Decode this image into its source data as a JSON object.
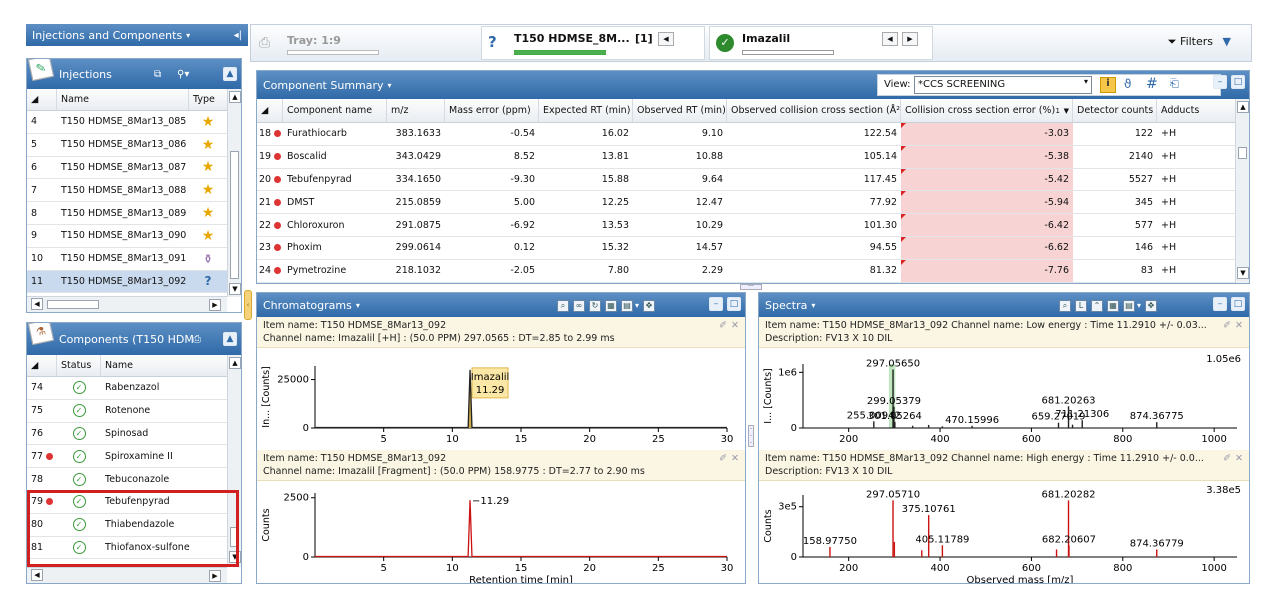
{
  "left_header": {
    "title": "Injections and Components"
  },
  "injections": {
    "title": "Injections",
    "columns": [
      "Name",
      "Type"
    ],
    "rows": [
      {
        "idx": "4",
        "name": "T150 HDMSE_8Mar13_085"
      },
      {
        "idx": "5",
        "name": "T150 HDMSE_8Mar13_086"
      },
      {
        "idx": "6",
        "name": "T150 HDMSE_8Mar13_087"
      },
      {
        "idx": "7",
        "name": "T150 HDMSE_8Mar13_088"
      },
      {
        "idx": "8",
        "name": "T150 HDMSE_8Mar13_089"
      },
      {
        "idx": "9",
        "name": "T150 HDMSE_8Mar13_090"
      },
      {
        "idx": "10",
        "name": "T150 HDMSE_8Mar13_091"
      },
      {
        "idx": "11",
        "name": "T150 HDMSE_8Mar13_092"
      }
    ]
  },
  "components": {
    "title": "Components (T150 HDM",
    "columns": [
      "Status",
      "Name"
    ],
    "rows": [
      {
        "idx": "74",
        "name": "Rabenzazol"
      },
      {
        "idx": "75",
        "name": "Rotenone"
      },
      {
        "idx": "76",
        "name": "Spinosad"
      },
      {
        "idx": "77",
        "name": "Spiroxamine II"
      },
      {
        "idx": "78",
        "name": "Tebuconazole"
      },
      {
        "idx": "79",
        "name": "Tebufenpyrad"
      },
      {
        "idx": "80",
        "name": "Thiabendazole"
      },
      {
        "idx": "81",
        "name": "Thiofanox-sulfone"
      }
    ]
  },
  "toolbar": {
    "tray_label": "Tray: 1:9",
    "injection_label": "T150 HDMSE_8M...",
    "injection_count": "[1]",
    "component_label": "Imazalil",
    "filters_label": "Filters"
  },
  "summary": {
    "title": "Component Summary",
    "view_label": "View:",
    "view_value": "*CCS SCREENING",
    "columns": [
      "Component name",
      "m/z",
      "Mass error (ppm)",
      "Expected RT (min)",
      "Observed RT (min)",
      "Observed collision cross section (Å²)",
      "Collision cross section error (%)",
      "Detector counts",
      "Adducts"
    ],
    "sort_marker": "1",
    "rows": [
      {
        "idx": "18",
        "name": "Furathiocarb",
        "mz": "383.1633",
        "err": "-0.54",
        "exp": "16.02",
        "obs": "9.10",
        "ccs": "122.54",
        "ccserr": "-3.03",
        "counts": "122",
        "adduct": "+H"
      },
      {
        "idx": "19",
        "name": "Boscalid",
        "mz": "343.0429",
        "err": "8.52",
        "exp": "13.81",
        "obs": "10.88",
        "ccs": "105.14",
        "ccserr": "-5.38",
        "counts": "2140",
        "adduct": "+H"
      },
      {
        "idx": "20",
        "name": "Tebufenpyrad",
        "mz": "334.1650",
        "err": "-9.30",
        "exp": "15.88",
        "obs": "9.64",
        "ccs": "117.45",
        "ccserr": "-5.42",
        "counts": "5527",
        "adduct": "+H"
      },
      {
        "idx": "21",
        "name": "DMST",
        "mz": "215.0859",
        "err": "5.00",
        "exp": "12.25",
        "obs": "12.47",
        "ccs": "77.92",
        "ccserr": "-5.94",
        "counts": "345",
        "adduct": "+H"
      },
      {
        "idx": "22",
        "name": "Chloroxuron",
        "mz": "291.0875",
        "err": "-6.92",
        "exp": "13.53",
        "obs": "10.29",
        "ccs": "101.30",
        "ccserr": "-6.42",
        "counts": "577",
        "adduct": "+H"
      },
      {
        "idx": "23",
        "name": "Phoxim",
        "mz": "299.0614",
        "err": "0.12",
        "exp": "15.32",
        "obs": "14.57",
        "ccs": "94.55",
        "ccserr": "-6.62",
        "counts": "146",
        "adduct": "+H"
      },
      {
        "idx": "24",
        "name": "Pymetrozine",
        "mz": "218.1032",
        "err": "-2.05",
        "exp": "7.80",
        "obs": "2.29",
        "ccs": "81.32",
        "ccserr": "-7.76",
        "counts": "83",
        "adduct": "+H"
      }
    ]
  },
  "chromatograms": {
    "title": "Chromatograms",
    "panel1": {
      "item": "Item name: T150 HDMSE_8Mar13_092",
      "channel": "Channel name: Imazalil [+H] : (50.0 PPM) 297.0565 : DT=2.85 to 2.99 ms"
    },
    "panel2": {
      "item": "Item name: T150 HDMSE_8Mar13_092",
      "channel": "Channel name: Imazalil [Fragment] : (50.0 PPM) 158.9775 : DT=2.77 to 2.90 ms"
    }
  },
  "spectra": {
    "title": "Spectra",
    "panel1": {
      "item": "Item name: T150 HDMSE_8Mar13_092   Channel name: Low energy : Time 11.2910 +/- 0.03...",
      "desc": "Description: FV13 X 10 DIL"
    },
    "panel2": {
      "item": "Item name: T150 HDMSE_8Mar13_092   Channel name: High energy : Time 11.2910 +/- 0.0...",
      "desc": "Description: FV13 X 10 DIL"
    }
  },
  "chart_data": [
    {
      "type": "line",
      "panel": "chromatogram-1",
      "ylabel": "In... [Counts]",
      "xlim": [
        0,
        30
      ],
      "ylim": [
        0,
        32000
      ],
      "xticks": [
        5,
        10,
        15,
        20,
        25,
        30
      ],
      "yticks": [
        {
          "v": 0,
          "label": "0"
        },
        {
          "v": 25000,
          "label": "25000"
        }
      ],
      "peaks": [
        {
          "x": 11.29,
          "y": 30000,
          "width": 0.14
        }
      ],
      "peak_label": {
        "text": "Imazalil",
        "value": "11.29"
      },
      "color": "#222222",
      "fill": "#c8a84a"
    },
    {
      "type": "line",
      "panel": "chromatogram-2",
      "ylabel": "Counts",
      "xlabel": "Retention time [min]",
      "xlim": [
        0,
        30
      ],
      "ylim": [
        0,
        2700
      ],
      "xticks": [
        5,
        10,
        15,
        20,
        25,
        30
      ],
      "yticks": [
        {
          "v": 0,
          "label": "0"
        },
        {
          "v": 2500,
          "label": "2500"
        }
      ],
      "peaks": [
        {
          "x": 11.29,
          "y": 2400,
          "width": 0.14
        }
      ],
      "annotations": [
        {
          "x": 11.29,
          "y": 2400,
          "text": "11.29"
        }
      ],
      "color": "#cc1111"
    },
    {
      "type": "bar",
      "panel": "spectrum-1",
      "ylabel": "I... [Counts]",
      "xlim": [
        100,
        1050
      ],
      "ylim": [
        0,
        1150000
      ],
      "xticks": [
        200,
        400,
        600,
        800,
        1000
      ],
      "yticks": [
        {
          "v": 0,
          "label": "0"
        },
        {
          "v": 1000000,
          "label": "1e6"
        }
      ],
      "max_label": "1.05e6",
      "highlight": [
        288,
        302
      ],
      "peaks": [
        {
          "x": 297.0565,
          "y": 1050000
        },
        {
          "x": 299.05379,
          "y": 380000
        },
        {
          "x": 255.00942,
          "y": 120000
        },
        {
          "x": 301.05264,
          "y": 110000
        },
        {
          "x": 470.15996,
          "y": 40000
        },
        {
          "x": 659.27019,
          "y": 95000
        },
        {
          "x": 681.20263,
          "y": 390000
        },
        {
          "x": 711.21306,
          "y": 140000
        },
        {
          "x": 874.36775,
          "y": 105000
        },
        {
          "x": 340,
          "y": 40000
        },
        {
          "x": 375,
          "y": 55000
        },
        {
          "x": 405,
          "y": 30000
        },
        {
          "x": 690,
          "y": 60000
        }
      ],
      "labels": [
        {
          "x": 297.0565,
          "y": 1050000,
          "text": "297.05650"
        },
        {
          "x": 299.05379,
          "y": 380000,
          "text": "299.05379"
        },
        {
          "x": 255.00942,
          "y": 120000,
          "text": "255.00942"
        },
        {
          "x": 301.05264,
          "y": 110000,
          "text": "301.05264"
        },
        {
          "x": 470.15996,
          "y": 40000,
          "text": "470.15996"
        },
        {
          "x": 659.27019,
          "y": 95000,
          "text": "659.27019"
        },
        {
          "x": 681.20263,
          "y": 390000,
          "text": "681.20263"
        },
        {
          "x": 711.21306,
          "y": 140000,
          "text": "711.21306"
        },
        {
          "x": 874.36775,
          "y": 105000,
          "text": "874.36775"
        }
      ],
      "color": "#222222"
    },
    {
      "type": "bar",
      "panel": "spectrum-2",
      "ylabel": "Counts",
      "xlabel": "Observed mass [m/z]",
      "xlim": [
        100,
        1050
      ],
      "ylim": [
        0,
        3700000
      ],
      "xticks": [
        200,
        400,
        600,
        800,
        1000
      ],
      "yticks": [
        {
          "v": 0,
          "label": "0"
        },
        {
          "v": 3000000,
          "label": "3e5"
        }
      ],
      "max_label": "3.38e5",
      "peaks": [
        {
          "x": 158.9775,
          "y": 600000
        },
        {
          "x": 297.0571,
          "y": 3380000
        },
        {
          "x": 375.10761,
          "y": 2500000
        },
        {
          "x": 405.11789,
          "y": 700000
        },
        {
          "x": 681.20282,
          "y": 3380000
        },
        {
          "x": 682.20607,
          "y": 700000
        },
        {
          "x": 874.36779,
          "y": 450000
        },
        {
          "x": 300,
          "y": 900000
        },
        {
          "x": 360,
          "y": 400000
        },
        {
          "x": 655,
          "y": 450000
        }
      ],
      "labels": [
        {
          "x": 158.9775,
          "y": 600000,
          "text": "158.97750"
        },
        {
          "x": 297.0571,
          "y": 3380000,
          "text": "297.05710"
        },
        {
          "x": 375.10761,
          "y": 2500000,
          "text": "375.10761"
        },
        {
          "x": 405.11789,
          "y": 700000,
          "text": "405.11789"
        },
        {
          "x": 681.20282,
          "y": 3380000,
          "text": "681.20282"
        },
        {
          "x": 682.20607,
          "y": 700000,
          "text": "682.20607"
        },
        {
          "x": 874.36779,
          "y": 450000,
          "text": "874.36779"
        }
      ],
      "color": "#cc1111"
    }
  ]
}
